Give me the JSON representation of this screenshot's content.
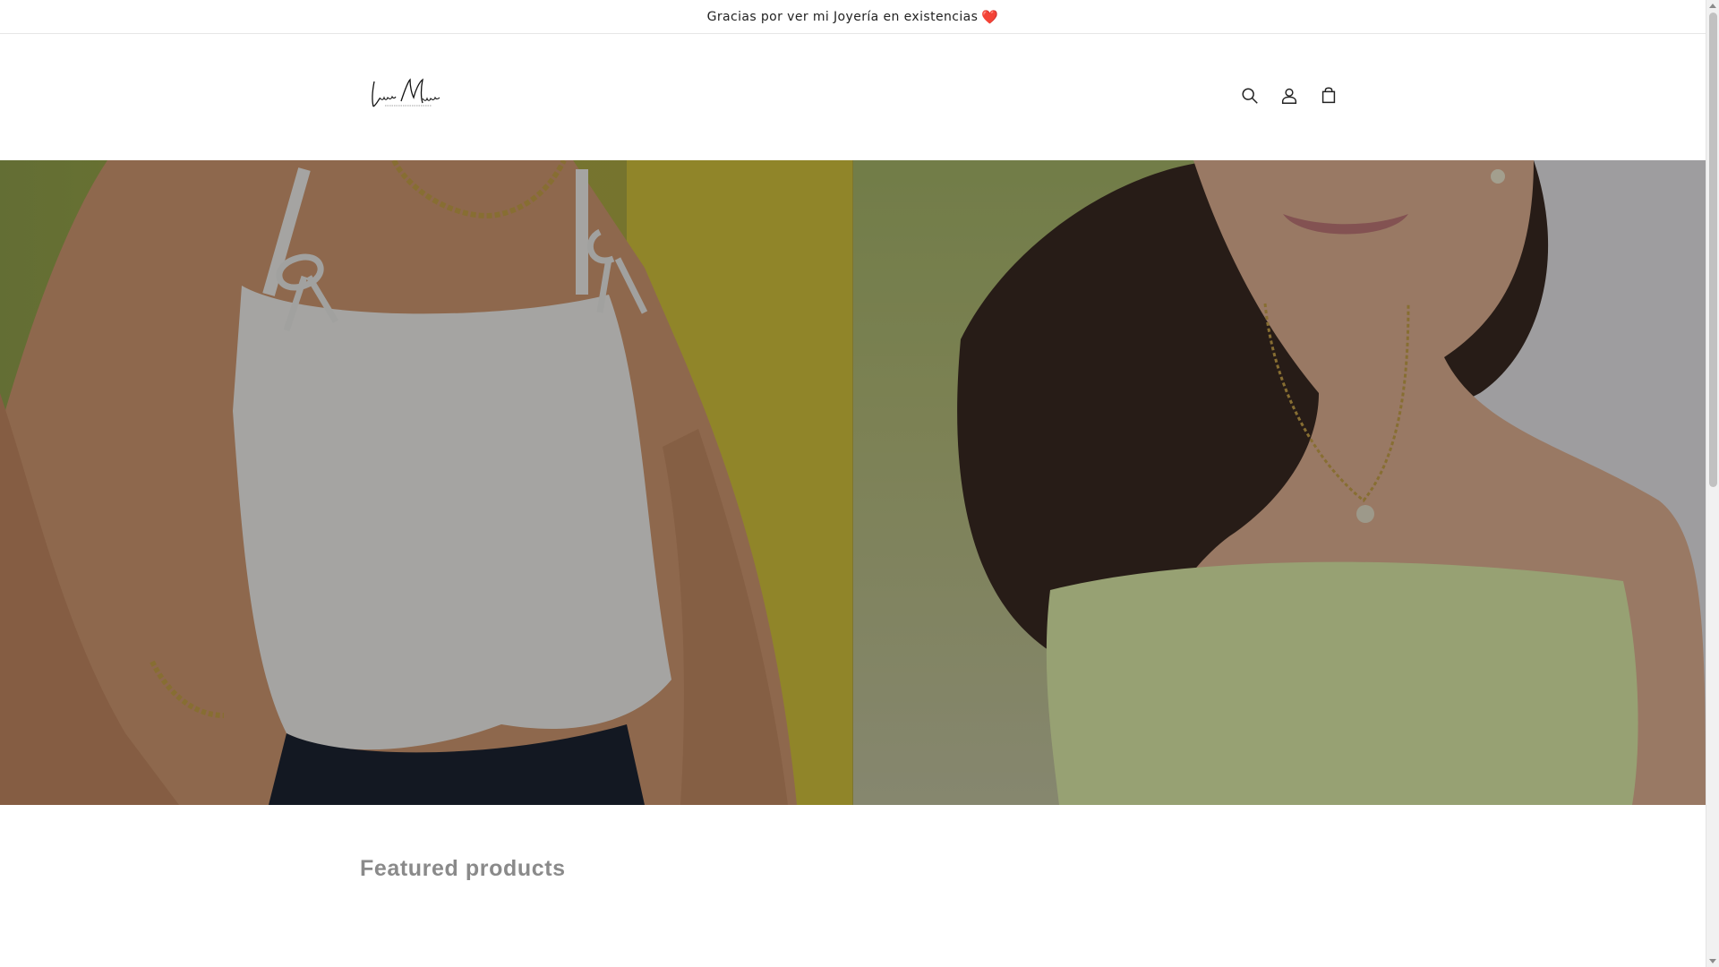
{
  "announcement": {
    "text": "Gracias por ver mi Joyería en existencias",
    "emoji": "❤️"
  },
  "header": {
    "logo_alt": "Luciana Moreno",
    "icons": [
      "search-icon",
      "account-icon",
      "cart-icon"
    ]
  },
  "hero": {
    "panels": [
      "left-model-photo",
      "right-model-photo"
    ],
    "overlay_color": "#000000"
  },
  "featured": {
    "title": "Featured products"
  },
  "colors": {
    "heart": "#e0112b",
    "title_gray": "#8a8a8a",
    "hero_left_bg": "#a8ab47",
    "hero_right_bg": "#b7bf7c"
  }
}
